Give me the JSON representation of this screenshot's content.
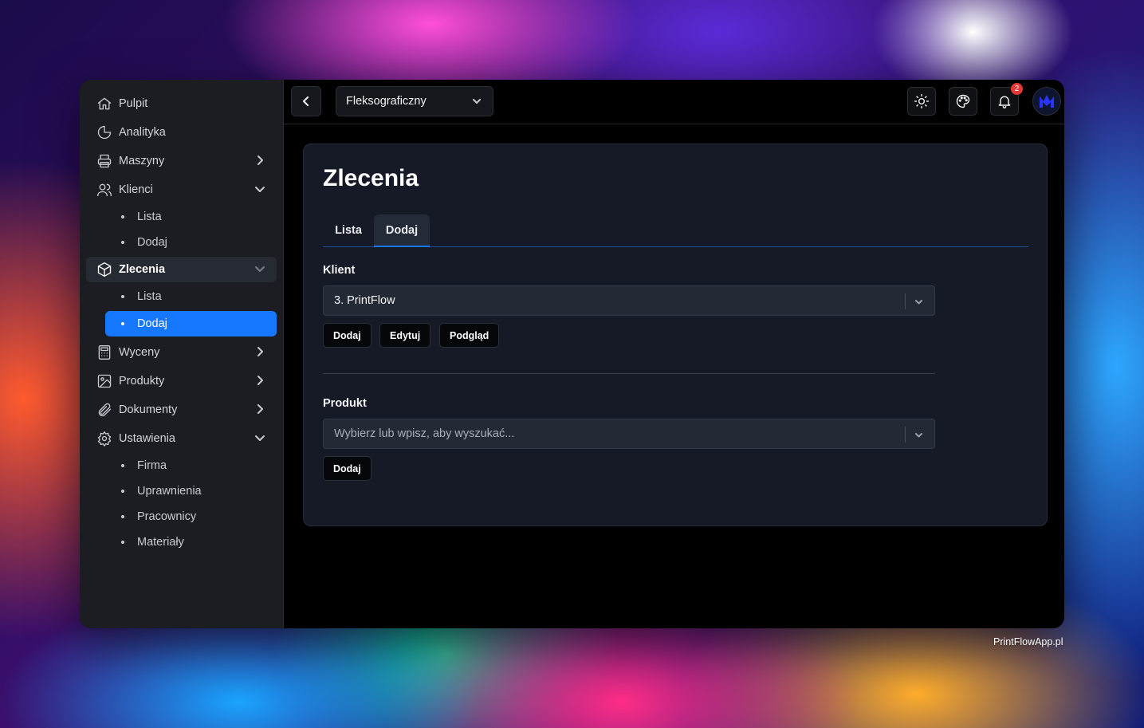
{
  "sidebar": {
    "items": [
      {
        "label": "Pulpit",
        "icon": "home-icon"
      },
      {
        "label": "Analityka",
        "icon": "pie-chart-icon"
      },
      {
        "label": "Maszyny",
        "icon": "printer-icon"
      },
      {
        "label": "Klienci",
        "icon": "users-icon"
      },
      {
        "label": "Zlecenia",
        "icon": "box-icon"
      },
      {
        "label": "Wyceny",
        "icon": "calculator-icon"
      },
      {
        "label": "Produkty",
        "icon": "image-icon"
      },
      {
        "label": "Dokumenty",
        "icon": "paperclip-icon"
      },
      {
        "label": "Ustawienia",
        "icon": "gear-icon"
      }
    ],
    "klienci_sub": [
      "Lista",
      "Dodaj"
    ],
    "zlecenia_sub": [
      "Lista",
      "Dodaj"
    ],
    "ustawienia_sub": [
      "Firma",
      "Uprawnienia",
      "Pracownicy",
      "Materiały"
    ]
  },
  "topbar": {
    "department": "Fleksograficzny",
    "notification_count": "2"
  },
  "page": {
    "title": "Zlecenia",
    "tabs": [
      {
        "label": "Lista",
        "active": false
      },
      {
        "label": "Dodaj",
        "active": true
      }
    ]
  },
  "form": {
    "client_label": "Klient",
    "client_value": "3. PrintFlow",
    "client_buttons": [
      "Dodaj",
      "Edytuj",
      "Podgląd"
    ],
    "product_label": "Produkt",
    "product_placeholder": "Wybierz lub wpisz, aby wyszukać...",
    "product_buttons": [
      "Dodaj"
    ]
  },
  "watermark": "PrintFlowApp.pl",
  "colors": {
    "accent": "#1677ff",
    "sidebar_bg": "#1b1d22",
    "card_bg": "#151a26",
    "badge": "#e53935"
  }
}
